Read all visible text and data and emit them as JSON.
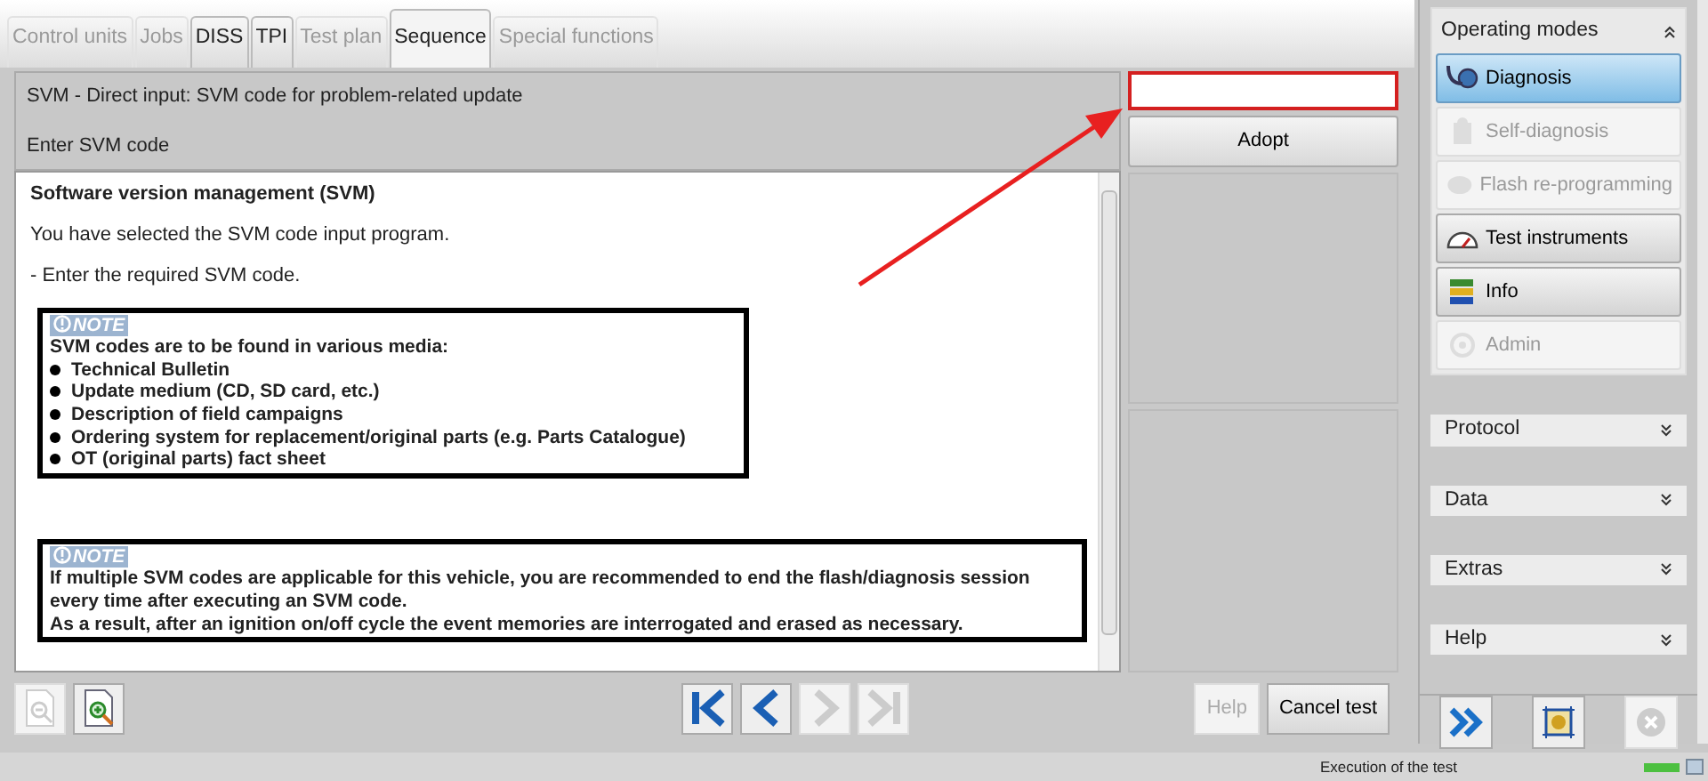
{
  "tabs": [
    {
      "label": "Control units",
      "disabled": true,
      "selected": false
    },
    {
      "label": "Jobs",
      "disabled": true,
      "selected": false
    },
    {
      "label": "DISS",
      "disabled": false,
      "selected": false
    },
    {
      "label": "TPI",
      "disabled": false,
      "selected": false
    },
    {
      "label": "Test plan",
      "disabled": true,
      "selected": false
    },
    {
      "label": "Sequence",
      "disabled": false,
      "selected": true
    },
    {
      "label": "Special functions",
      "disabled": true,
      "selected": false
    }
  ],
  "header": {
    "title": "SVM - Direct input: SVM code for problem-related update",
    "prompt": "Enter SVM code"
  },
  "adopt_button": "Adopt",
  "content": {
    "title": "Software version management (SVM)",
    "paragraphs": [
      "You have selected the SVM code input program.",
      "- Enter the required SVM code."
    ],
    "notes": [
      {
        "label": "NOTE",
        "lines": [
          "SVM codes are to be found in various media:"
        ],
        "bullets": [
          "Technical Bulletin",
          "Update medium (CD, SD card, etc.)",
          "Description of field campaigns",
          "Ordering system for replacement/original parts (e.g. Parts Catalogue)",
          "OT (original parts) fact sheet"
        ]
      },
      {
        "label": "NOTE",
        "lines": [
          "If multiple SVM codes are applicable for this vehicle, you are recommended to end the flash/diagnosis session every time after executing an SVM code.",
          "As a result, after an ignition on/off cycle the event memories are interrogated and erased as necessary."
        ]
      }
    ]
  },
  "toolbar": {
    "zoom": [
      {
        "kind": "zoom-out",
        "disabled": true
      },
      {
        "kind": "zoom-in",
        "disabled": false
      }
    ],
    "navigation": [
      {
        "kind": "first",
        "disabled": false
      },
      {
        "kind": "previous",
        "disabled": false
      },
      {
        "kind": "next",
        "disabled": true
      },
      {
        "kind": "last",
        "disabled": true
      }
    ],
    "buttons": [
      {
        "label": "Help",
        "disabled": true
      },
      {
        "label": "Cancel test",
        "disabled": false
      }
    ]
  },
  "sidebar": {
    "title": "Operating modes",
    "modes": [
      {
        "label": "Diagnosis",
        "kind": "diagnosis",
        "disabled": false,
        "selected": true
      },
      {
        "label": "Self-diagnosis",
        "kind": "self-diagnosis",
        "disabled": true,
        "selected": false
      },
      {
        "label": "Flash re-programming",
        "kind": "flash",
        "disabled": true,
        "selected": false
      },
      {
        "label": "Test instruments",
        "kind": "instruments",
        "disabled": false,
        "selected": false
      },
      {
        "label": "Info",
        "kind": "info",
        "disabled": false,
        "selected": false
      },
      {
        "label": "Admin",
        "kind": "admin",
        "disabled": true,
        "selected": false
      }
    ],
    "sections": [
      "Protocol",
      "Data",
      "Extras",
      "Help"
    ],
    "actions": [
      {
        "kind": "forward",
        "disabled": false
      },
      {
        "kind": "frame",
        "disabled": false
      },
      {
        "kind": "cancel",
        "disabled": true
      }
    ]
  },
  "status_bar": {
    "text": "Execution of the test"
  }
}
